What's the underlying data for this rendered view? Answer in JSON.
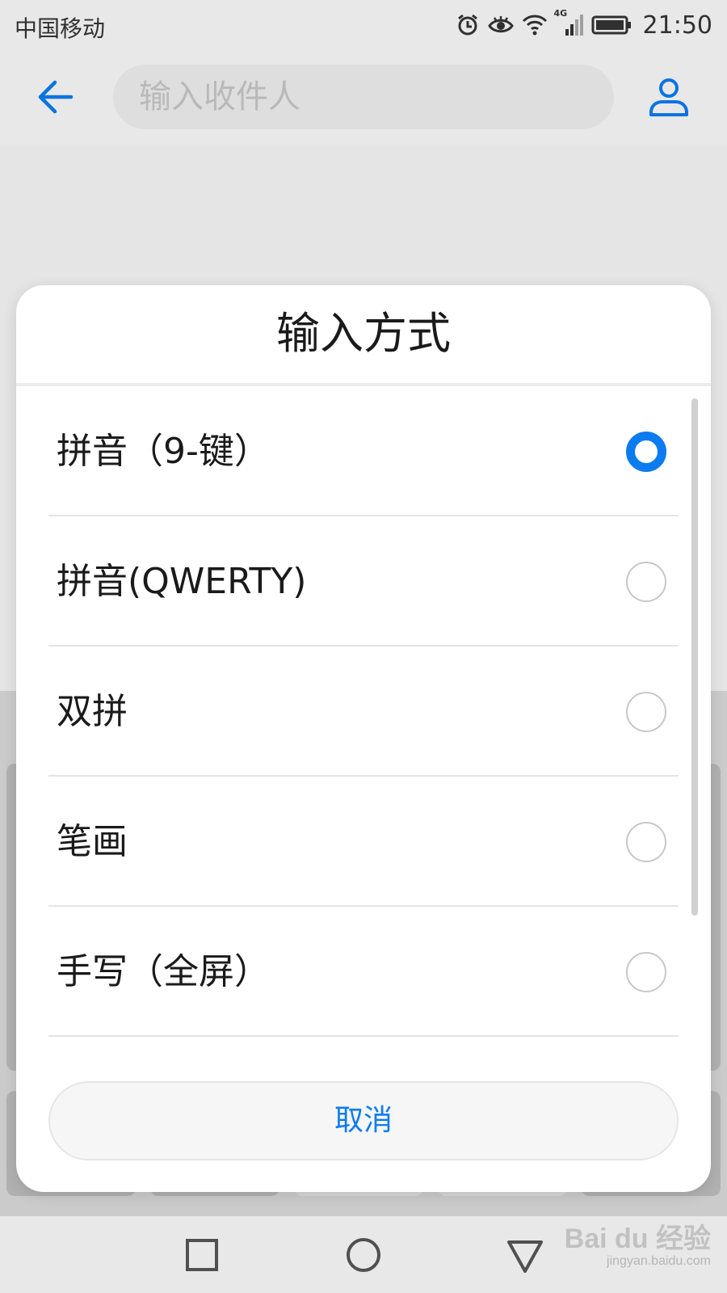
{
  "status_bar": {
    "carrier": "中国移动",
    "network": "4G",
    "time": "21:50"
  },
  "top_bar": {
    "back_icon": "arrow-left-icon",
    "recipient_placeholder": "输入收件人",
    "contact_icon": "person-icon"
  },
  "dialog": {
    "title": "输入方式",
    "options": [
      {
        "label": "拼音（9-键）",
        "selected": true
      },
      {
        "label": "拼音(QWERTY)",
        "selected": false
      },
      {
        "label": "双拼",
        "selected": false
      },
      {
        "label": "笔画",
        "selected": false
      },
      {
        "label": "手写（全屏）",
        "selected": false
      }
    ],
    "cancel_label": "取消"
  },
  "nav_bar": {
    "recents_icon": "square-icon",
    "home_icon": "circle-icon",
    "back_icon": "triangle-back-icon"
  },
  "watermark": {
    "brand": "Bai du 经验",
    "url": "jingyan.baidu.com"
  },
  "colors": {
    "accent": "#0a7cf0",
    "dialog_bg": "#ffffff",
    "page_bg": "#f4f4f4"
  }
}
